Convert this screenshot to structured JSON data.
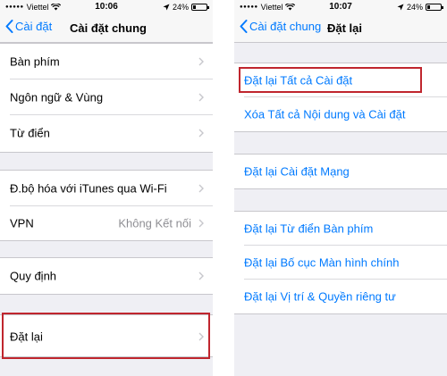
{
  "left": {
    "status": {
      "carrier": "Viettel",
      "time": "10:06",
      "battery": "24%",
      "battery_level": 0.24
    },
    "nav": {
      "back_label": "Cài đặt",
      "title": "Cài đặt chung"
    },
    "group1": [
      "Bàn phím",
      "Ngôn ngữ & Vùng",
      "Từ điển"
    ],
    "group2": {
      "itunes_sync": "Đ.bộ hóa với iTunes qua Wi-Fi",
      "vpn_label": "VPN",
      "vpn_value": "Không Kết nối"
    },
    "group3": [
      "Quy định"
    ],
    "group4": [
      "Đặt lại"
    ]
  },
  "right": {
    "status": {
      "carrier": "Viettel",
      "time": "10:07",
      "battery": "24%",
      "battery_level": 0.24
    },
    "nav": {
      "back_label": "Cài đặt chung",
      "title": "Đặt lại"
    },
    "group1": [
      "Đặt lại Tất cả Cài đặt",
      "Xóa Tất cả Nội dung và Cài đặt"
    ],
    "group2": [
      "Đặt lại Cài đặt Mạng"
    ],
    "group3": [
      "Đặt lại Từ điển Bàn phím",
      "Đặt lại Bố cục Màn hình chính",
      "Đặt lại Vị trí & Quyền riêng tư"
    ]
  },
  "colors": {
    "accent": "#007aff",
    "highlight": "#c0262e",
    "background": "#efeff4"
  },
  "icons": [
    "signal-dots-icon",
    "wifi-icon",
    "location-icon",
    "battery-icon",
    "back-chevron-icon",
    "chevron-right-icon"
  ]
}
